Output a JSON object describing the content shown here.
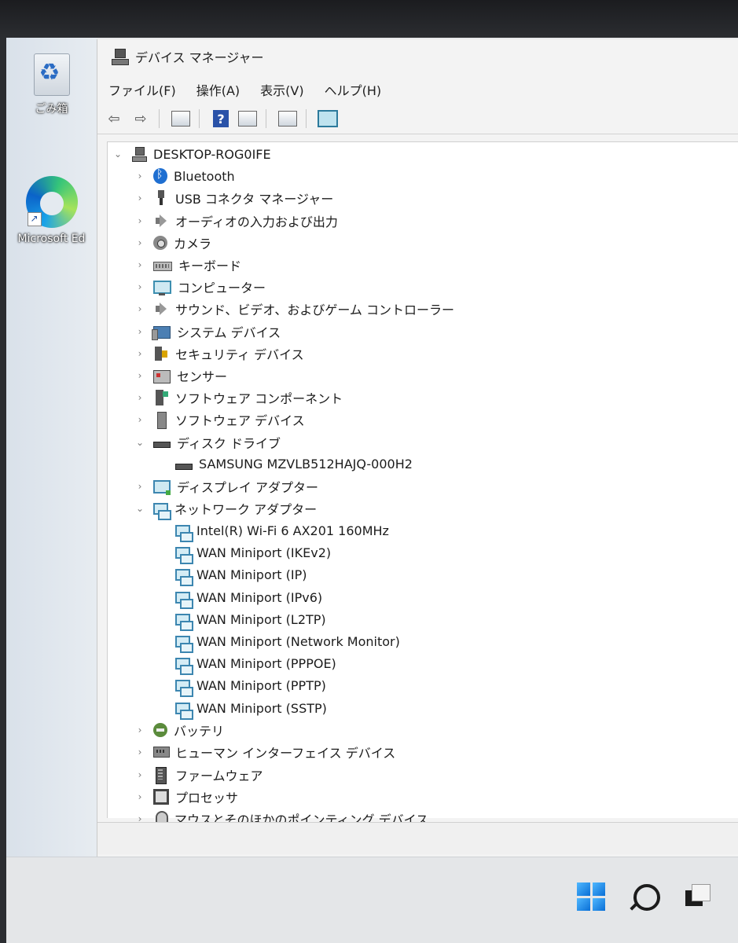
{
  "desktop": {
    "recycle_bin_label": "ごみ箱",
    "edge_label": "Microsoft Ed",
    "shortcut_arrow": "↗"
  },
  "window": {
    "title": "デバイス マネージャー",
    "menu": [
      "ファイル(F)",
      "操作(A)",
      "表示(V)",
      "ヘルプ(H)"
    ],
    "toolbar": {
      "back_glyph": "⇦",
      "forward_glyph": "⇨",
      "help_glyph": "?"
    }
  },
  "tree": {
    "root": "DESKTOP-ROG0IFE",
    "chevron_collapsed": "›",
    "chevron_expanded": "⌄",
    "items": [
      {
        "label": "Bluetooth",
        "icon": "bluetooth-icon",
        "cls": "i-bt"
      },
      {
        "label": "USB コネクタ マネージャー",
        "icon": "usb-icon",
        "cls": "i-usb"
      },
      {
        "label": "オーディオの入力および出力",
        "icon": "speaker-icon",
        "cls": "i-spk"
      },
      {
        "label": "カメラ",
        "icon": "camera-icon",
        "cls": "i-cam"
      },
      {
        "label": "キーボード",
        "icon": "keyboard-icon",
        "cls": "i-kb"
      },
      {
        "label": "コンピューター",
        "icon": "monitor-icon",
        "cls": "i-mon"
      },
      {
        "label": "サウンド、ビデオ、およびゲーム コントローラー",
        "icon": "speaker-icon",
        "cls": "i-spk"
      },
      {
        "label": "システム デバイス",
        "icon": "system-device-icon",
        "cls": "i-sys"
      },
      {
        "label": "セキュリティ デバイス",
        "icon": "security-device-icon",
        "cls": "i-sec"
      },
      {
        "label": "センサー",
        "icon": "sensor-icon",
        "cls": "i-sen"
      },
      {
        "label": "ソフトウェア コンポーネント",
        "icon": "software-component-icon",
        "cls": "i-swc"
      },
      {
        "label": "ソフトウェア デバイス",
        "icon": "software-device-icon",
        "cls": "i-swd"
      },
      {
        "label": "ディスク ドライブ",
        "icon": "disk-drive-icon",
        "cls": "i-disk",
        "expanded": true,
        "children": [
          {
            "label": "SAMSUNG MZVLB512HAJQ-000H2",
            "icon": "disk-drive-icon",
            "cls": "i-disk"
          }
        ]
      },
      {
        "label": "ディスプレイ アダプター",
        "icon": "display-adapter-icon",
        "cls": "i-disp"
      },
      {
        "label": "ネットワーク アダプター",
        "icon": "network-adapter-icon",
        "cls": "i-net",
        "expanded": true,
        "children": [
          {
            "label": "Intel(R) Wi-Fi 6 AX201 160MHz",
            "icon": "network-adapter-icon",
            "cls": "i-net"
          },
          {
            "label": "WAN Miniport (IKEv2)",
            "icon": "network-adapter-icon",
            "cls": "i-net"
          },
          {
            "label": "WAN Miniport (IP)",
            "icon": "network-adapter-icon",
            "cls": "i-net"
          },
          {
            "label": "WAN Miniport (IPv6)",
            "icon": "network-adapter-icon",
            "cls": "i-net"
          },
          {
            "label": "WAN Miniport (L2TP)",
            "icon": "network-adapter-icon",
            "cls": "i-net"
          },
          {
            "label": "WAN Miniport (Network Monitor)",
            "icon": "network-adapter-icon",
            "cls": "i-net"
          },
          {
            "label": "WAN Miniport (PPPOE)",
            "icon": "network-adapter-icon",
            "cls": "i-net"
          },
          {
            "label": "WAN Miniport (PPTP)",
            "icon": "network-adapter-icon",
            "cls": "i-net"
          },
          {
            "label": "WAN Miniport (SSTP)",
            "icon": "network-adapter-icon",
            "cls": "i-net"
          }
        ]
      },
      {
        "label": "バッテリ",
        "icon": "battery-icon",
        "cls": "i-bat"
      },
      {
        "label": "ヒューマン インターフェイス デバイス",
        "icon": "hid-icon",
        "cls": "i-hid"
      },
      {
        "label": "ファームウェア",
        "icon": "firmware-icon",
        "cls": "i-fw"
      },
      {
        "label": "プロセッサ",
        "icon": "processor-icon",
        "cls": "i-cpu"
      },
      {
        "label": "マウスとそのほかのポインティング デバイス",
        "icon": "mouse-icon",
        "cls": "i-mouse"
      }
    ]
  },
  "taskbar": {
    "start_icon": "windows-start-icon",
    "search_icon": "search-icon",
    "task_view_icon": "task-view-icon"
  }
}
